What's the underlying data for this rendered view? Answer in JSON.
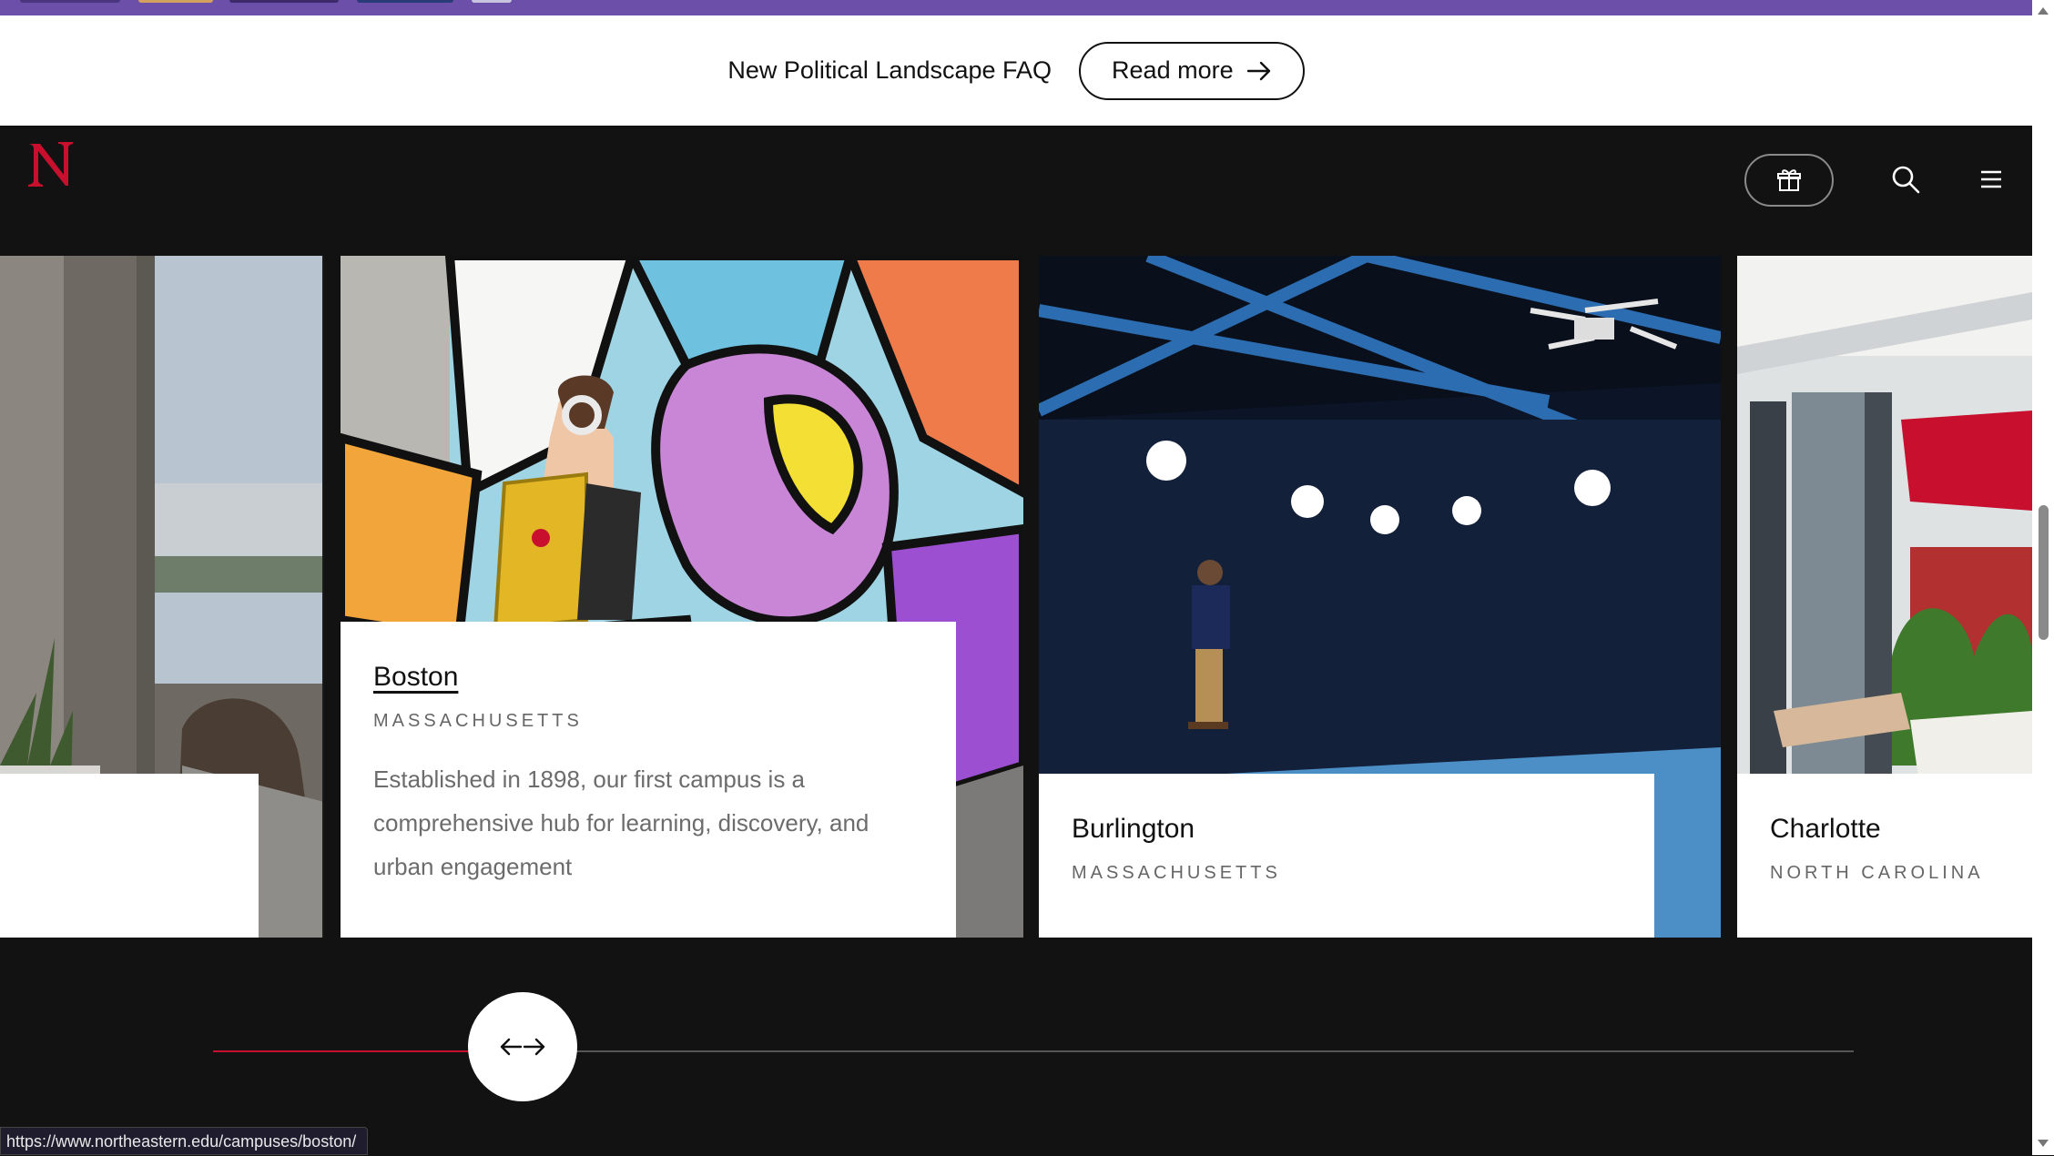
{
  "announcement": {
    "text": "New Political Landscape FAQ",
    "button_label": "Read more"
  },
  "header": {
    "logo_letter": "N",
    "icons": [
      "gift-icon",
      "search-icon",
      "menu-icon"
    ]
  },
  "colors": {
    "brand_red": "#c8102e",
    "header_bg": "#121212",
    "top_strip": "#6b4fa8"
  },
  "campuses": [
    {
      "city": "Boston",
      "state": "MASSACHUSETTS",
      "description": "Established in 1898, our first campus is a comprehensive hub for learning, discovery, and urban engagement"
    },
    {
      "city": "Burlington",
      "state": "MASSACHUSETTS"
    },
    {
      "city": "Charlotte",
      "state": "NORTH CAROLINA"
    }
  ],
  "slider": {
    "progress": 0.2
  },
  "status_url": "https://www.northeastern.edu/campuses/boston/"
}
